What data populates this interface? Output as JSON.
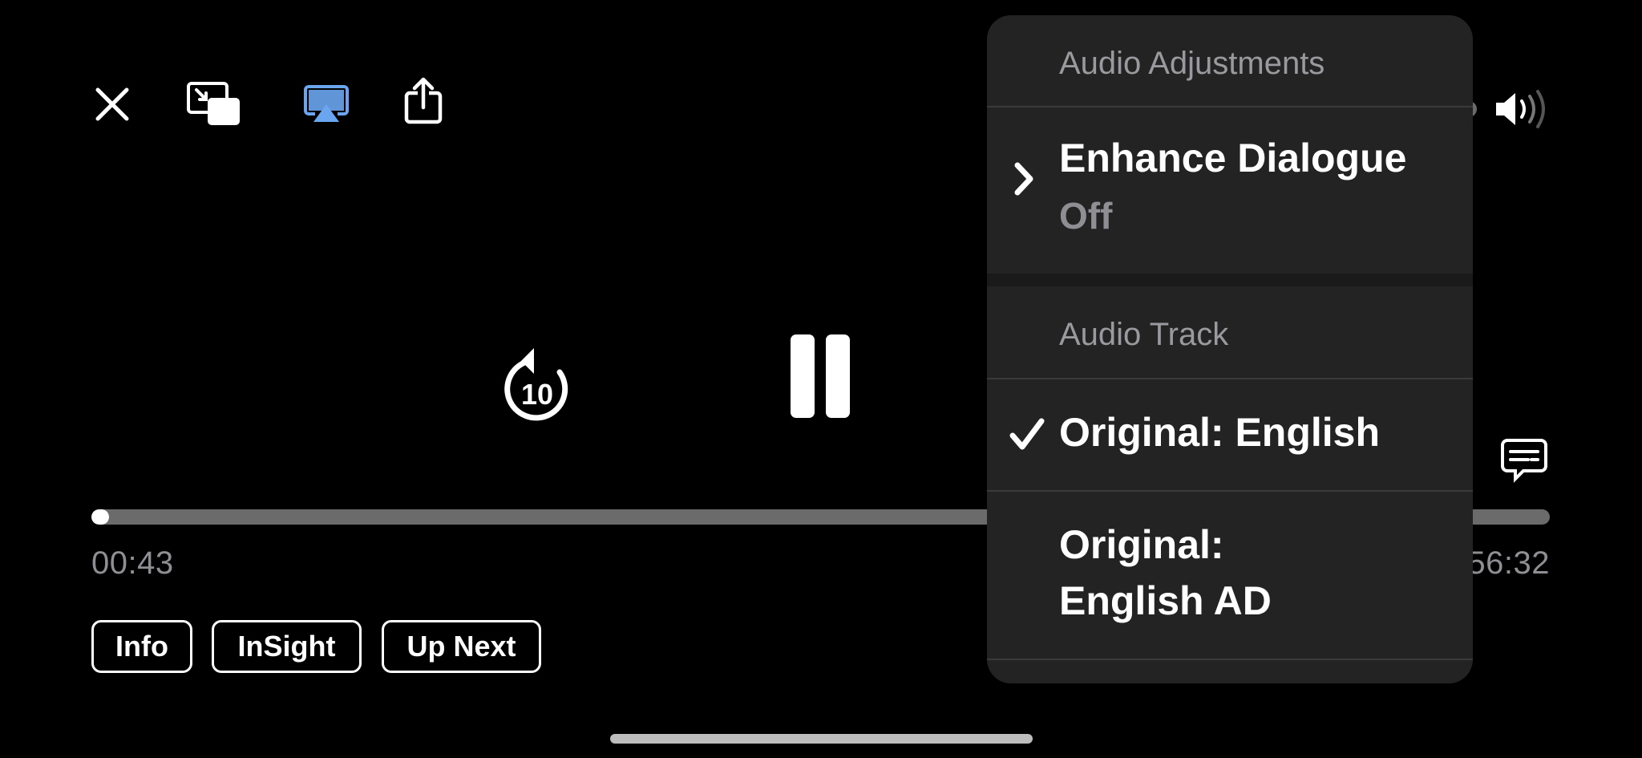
{
  "player": {
    "elapsed": "00:43",
    "remaining": "56:32",
    "progress_fraction": 0.012,
    "skip_back_seconds": "10"
  },
  "toolbar": {
    "icons": [
      "close-icon",
      "picture-in-picture-icon",
      "airplay-icon",
      "share-icon"
    ],
    "airplay_color": "#6aa6f0"
  },
  "chips": [
    {
      "label": "Info"
    },
    {
      "label": "InSight"
    },
    {
      "label": "Up Next"
    }
  ],
  "audio_menu": {
    "adjustments_header": "Audio Adjustments",
    "enhance_dialogue": {
      "title": "Enhance Dialogue",
      "value": "Off"
    },
    "track_header": "Audio Track",
    "tracks": [
      {
        "line1": "Original: English",
        "line2": "",
        "selected": true
      },
      {
        "line1": "Original:",
        "line2": "English AD",
        "selected": false
      }
    ]
  },
  "right_controls": {
    "volume_icon": "speaker-volume-icon",
    "subtitles_icon": "subtitles-icon"
  }
}
